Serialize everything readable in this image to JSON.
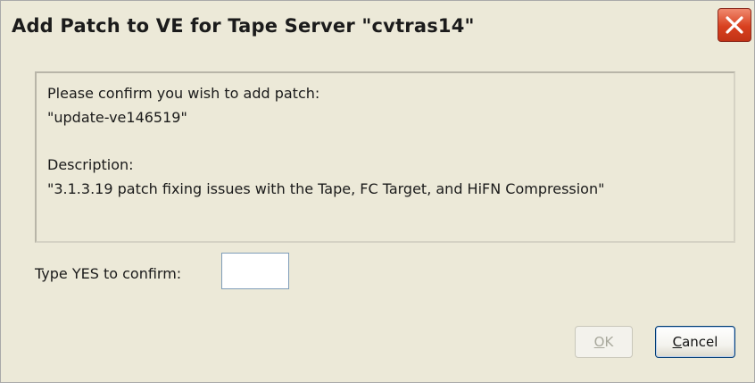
{
  "window": {
    "title": "Add Patch to VE for Tape Server \"cvtras14\"",
    "close_icon": "close-x-icon"
  },
  "info": {
    "line1": "Please confirm you wish to add patch:",
    "line2": "\"update-ve146519\"",
    "line3": "Description:",
    "line4": "\"3.1.3.19 patch fixing issues with the Tape, FC Target, and HiFN Compression\""
  },
  "confirm": {
    "label": "Type YES to confirm:",
    "value": ""
  },
  "buttons": {
    "ok_mnemonic": "O",
    "ok_rest": "K",
    "ok_enabled": false,
    "cancel_mnemonic": "C",
    "cancel_rest": "ancel"
  },
  "colors": {
    "dialog_bg": "#ece9d8",
    "close_button": "#d8401f",
    "disabled_text": "#a8a89c"
  }
}
